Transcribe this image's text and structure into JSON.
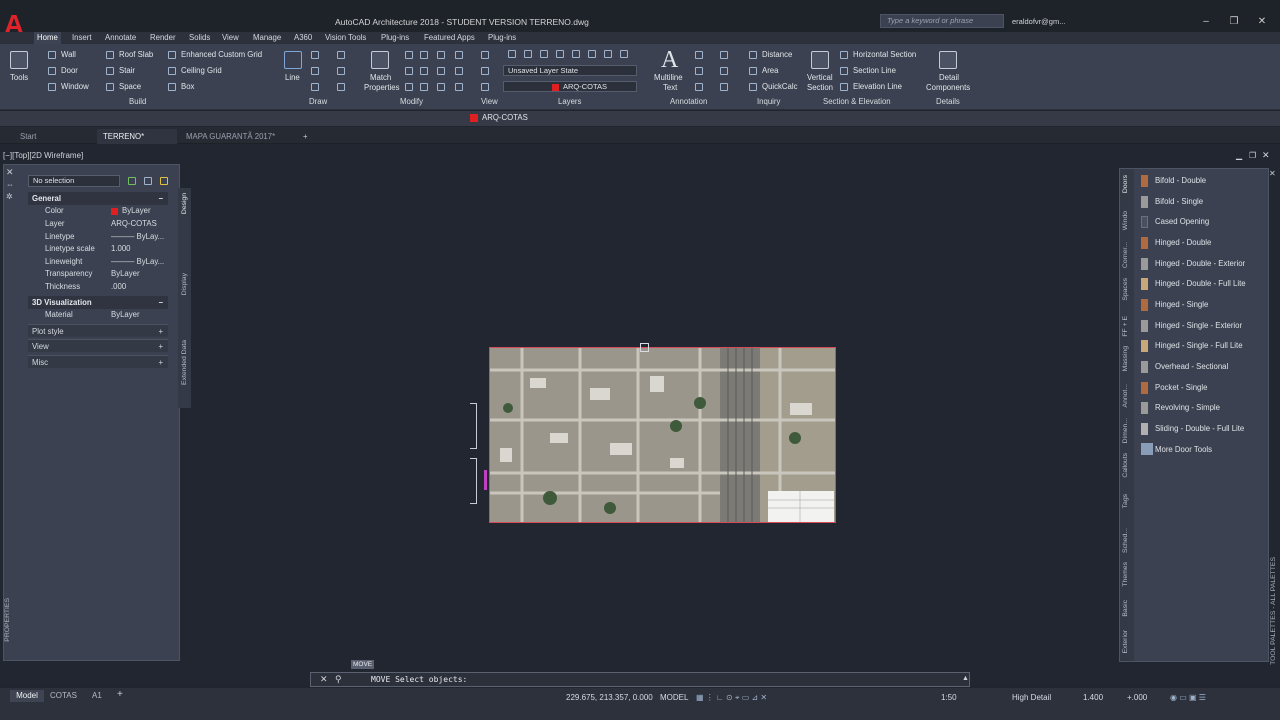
{
  "titlebar": {
    "title": "AutoCAD Architecture 2018 - STUDENT VERSION    TERRENO.dwg",
    "search_placeholder": "Type a keyword or phrase",
    "user": "eraldofvr@gm...",
    "minimize": "–",
    "maximize": "❐",
    "close": "✕"
  },
  "menu": [
    "Home",
    "Insert",
    "Annotate",
    "Render",
    "Solids",
    "View",
    "Manage",
    "A360",
    "Vision Tools",
    "Plug-ins",
    "Featured Apps",
    "Plug-ins"
  ],
  "ribbon": {
    "tools": "Tools",
    "build": {
      "wall": "Wall",
      "door": "Door",
      "window": "Window",
      "roof_slab": "Roof Slab",
      "stair": "Stair",
      "space": "Space",
      "grid": "Enhanced Custom Grid",
      "ceiling": "Ceiling Grid",
      "box": "Box",
      "label": "Build"
    },
    "draw": {
      "line": "Line",
      "label": "Draw"
    },
    "modify": {
      "match1": "Match",
      "match2": "Properties",
      "label": "Modify"
    },
    "view": {
      "label": "View"
    },
    "layers": {
      "state": "Unsaved Layer State",
      "layer": "ARQ-COTAS",
      "label": "Layers"
    },
    "annotation": {
      "mt1": "Multiline",
      "mt2": "Text",
      "label": "Annotation"
    },
    "inquiry": {
      "distance": "Distance",
      "area": "Area",
      "quickcalc": "QuickCalc",
      "label": "Inquiry"
    },
    "section": {
      "vs1": "Vertical",
      "vs2": "Section",
      "hs": "Horizontal Section",
      "sl": "Section Line",
      "el": "Elevation Line",
      "label": "Section & Elevation"
    },
    "details": {
      "d1": "Detail",
      "d2": "Components",
      "label": "Details"
    }
  },
  "qat": {
    "layer": "ARQ-COTAS"
  },
  "doctabs": [
    "Start",
    "TERRENO*",
    "MAPA GUARANTÃ 2017*"
  ],
  "viewport_label": "[−][Top][2D Wireframe]",
  "properties": {
    "selection": "No selection",
    "general": "General",
    "rows": [
      [
        "Color",
        "ByLayer"
      ],
      [
        "Layer",
        "ARQ-COTAS"
      ],
      [
        "Linetype",
        "——— ByLay..."
      ],
      [
        "Linetype scale",
        "1.000"
      ],
      [
        "Lineweight",
        "——— ByLay..."
      ],
      [
        "Transparency",
        "ByLayer"
      ],
      [
        "Thickness",
        ".000"
      ]
    ],
    "viz": "3D Visualization",
    "material": [
      "Material",
      "ByLayer"
    ],
    "plot": "Plot style",
    "view": "View",
    "misc": "Misc",
    "tabs": [
      "Design",
      "Display",
      "Extended Data"
    ],
    "sidetitle": "PROPERTIES"
  },
  "palette": {
    "items": [
      "Bifold - Double",
      "Bifold - Single",
      "Cased Opening",
      "Hinged - Double",
      "Hinged - Double - Exterior",
      "Hinged - Double - Full Lite",
      "Hinged - Single",
      "Hinged - Single - Exterior",
      "Hinged - Single - Full Lite",
      "Overhead - Sectional",
      "Pocket - Single",
      "Revolving - Simple",
      "Sliding - Double - Full Lite",
      "More Door Tools"
    ],
    "tabs": [
      "Doors",
      "Windo",
      "Corner...",
      "Spaces",
      "FF + E",
      "Massing",
      "Annot...",
      "Dimen...",
      "Callouts",
      "Tags",
      "Sched...",
      "Themes",
      "Basic",
      "Exterior"
    ],
    "sidetitle": "TOOL PALETTES - ALL PALETTES"
  },
  "command": {
    "tooltip": "MOVE",
    "text": "MOVE Select objects:"
  },
  "status": {
    "layout_tabs": [
      "Model",
      "COTAS",
      "A1"
    ],
    "coords": "229.675, 213.357, 0.000",
    "model": "MODEL",
    "scale": "1:50",
    "detail": "High Detail",
    "lw": "1.400",
    "elev": "+.000"
  }
}
